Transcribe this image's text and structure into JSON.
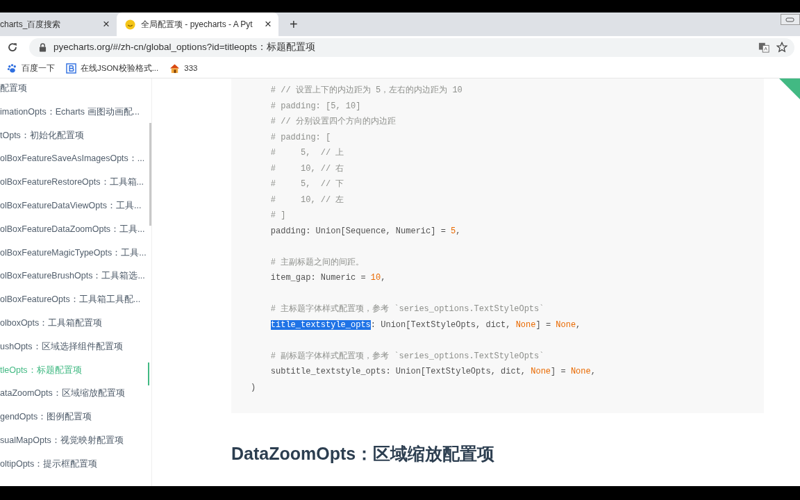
{
  "browser": {
    "tabs": [
      {
        "title": "charts_百度搜索",
        "selected": false,
        "close": "×"
      },
      {
        "title": "全局配置项 - pyecharts - A Pyt",
        "selected": true,
        "close": "×"
      }
    ],
    "new_tab": "+",
    "url": "pyecharts.org/#/zh-cn/global_options?id=titleopts：标题配置项",
    "bookmarks": [
      {
        "label": "百度一下",
        "kind": "paw"
      },
      {
        "label": "在线JSON校验格式...",
        "kind": "b"
      },
      {
        "label": "333",
        "kind": "house"
      }
    ]
  },
  "sidebar": {
    "items": [
      {
        "label": "配置项",
        "selected": false
      },
      {
        "label": "imationOpts：Echarts 画图动画配...",
        "selected": false
      },
      {
        "label": "tOpts：初始化配置项",
        "selected": false
      },
      {
        "label": "olBoxFeatureSaveAsImagesOpts：...",
        "selected": false
      },
      {
        "label": "olBoxFeatureRestoreOpts：工具箱...",
        "selected": false
      },
      {
        "label": "olBoxFeatureDataViewOpts：工具...",
        "selected": false
      },
      {
        "label": "olBoxFeatureDataZoomOpts：工具...",
        "selected": false
      },
      {
        "label": "olBoxFeatureMagicTypeOpts：工具...",
        "selected": false
      },
      {
        "label": "olBoxFeatureBrushOpts：工具箱选...",
        "selected": false
      },
      {
        "label": "olBoxFeatureOpts：工具箱工具配...",
        "selected": false
      },
      {
        "label": "olboxOpts：工具箱配置项",
        "selected": false
      },
      {
        "label": "ushOpts：区域选择组件配置项",
        "selected": false
      },
      {
        "label": "tleOpts：标题配置项",
        "selected": true
      },
      {
        "label": "ataZoomOpts：区域缩放配置项",
        "selected": false
      },
      {
        "label": "gendOpts：图例配置项",
        "selected": false
      },
      {
        "label": "sualMapOpts：视觉映射配置项",
        "selected": false
      },
      {
        "label": "oltipOpts：提示框配置项",
        "selected": false
      }
    ]
  },
  "code": {
    "lines": [
      {
        "kind": "code",
        "indent": true,
        "segments": [
          {
            "text": "# // 设置上下的内边距为 5，左右的内边距为 10",
            "kind": "comment"
          }
        ]
      },
      {
        "kind": "code",
        "indent": true,
        "segments": [
          {
            "text": "# padding: [5, 10]",
            "kind": "comment"
          }
        ]
      },
      {
        "kind": "code",
        "indent": true,
        "segments": [
          {
            "text": "# // 分别设置四个方向的内边距",
            "kind": "comment"
          }
        ]
      },
      {
        "kind": "code",
        "indent": true,
        "segments": [
          {
            "text": "# padding: [",
            "kind": "comment"
          }
        ]
      },
      {
        "kind": "code",
        "indent": true,
        "segments": [
          {
            "text": "#     5,  // 上",
            "kind": "comment"
          }
        ]
      },
      {
        "kind": "code",
        "indent": true,
        "segments": [
          {
            "text": "#     10, // 右",
            "kind": "comment"
          }
        ]
      },
      {
        "kind": "code",
        "indent": true,
        "segments": [
          {
            "text": "#     5,  // 下",
            "kind": "comment"
          }
        ]
      },
      {
        "kind": "code",
        "indent": true,
        "segments": [
          {
            "text": "#     10, // 左",
            "kind": "comment"
          }
        ]
      },
      {
        "kind": "code",
        "indent": true,
        "segments": [
          {
            "text": "# ]",
            "kind": "comment"
          }
        ]
      },
      {
        "kind": "code",
        "indent": true,
        "segments": [
          {
            "text": "padding: Union[Sequence, Numeric] = ",
            "kind": "plain"
          },
          {
            "text": "5",
            "kind": "number"
          },
          {
            "text": ",",
            "kind": "plain"
          }
        ]
      },
      {
        "kind": "blank"
      },
      {
        "kind": "code",
        "indent": true,
        "segments": [
          {
            "text": "# 主副标题之间的间距。",
            "kind": "comment"
          }
        ]
      },
      {
        "kind": "code",
        "indent": true,
        "segments": [
          {
            "text": "item_gap: Numeric = ",
            "kind": "plain"
          },
          {
            "text": "10",
            "kind": "number"
          },
          {
            "text": ",",
            "kind": "plain"
          }
        ]
      },
      {
        "kind": "blank"
      },
      {
        "kind": "code",
        "indent": true,
        "segments": [
          {
            "text": "# 主标题字体样式配置项，参考 `series_options.TextStyleOpts`",
            "kind": "comment"
          }
        ]
      },
      {
        "kind": "code",
        "indent": true,
        "segments": [
          {
            "text": "title_textstyle_opts",
            "kind": "selection"
          },
          {
            "text": ": Union[TextStyleOpts, dict, ",
            "kind": "plain"
          },
          {
            "text": "None",
            "kind": "keyword"
          },
          {
            "text": "] = ",
            "kind": "plain"
          },
          {
            "text": "None",
            "kind": "keyword"
          },
          {
            "text": ",",
            "kind": "plain"
          }
        ]
      },
      {
        "kind": "blank"
      },
      {
        "kind": "code",
        "indent": true,
        "segments": [
          {
            "text": "# 副标题字体样式配置项，参考 `series_options.TextStyleOpts`",
            "kind": "comment"
          }
        ]
      },
      {
        "kind": "code",
        "indent": true,
        "segments": [
          {
            "text": "subtitle_textstyle_opts: Union[TextStyleOpts, dict, ",
            "kind": "plain"
          },
          {
            "text": "None",
            "kind": "keyword"
          },
          {
            "text": "] = ",
            "kind": "plain"
          },
          {
            "text": "None",
            "kind": "keyword"
          },
          {
            "text": ",",
            "kind": "plain"
          }
        ]
      },
      {
        "kind": "code",
        "indent": false,
        "segments": [
          {
            "text": ")",
            "kind": "plain"
          }
        ]
      }
    ]
  },
  "heading": "DataZoomOpts：区域缩放配置项"
}
